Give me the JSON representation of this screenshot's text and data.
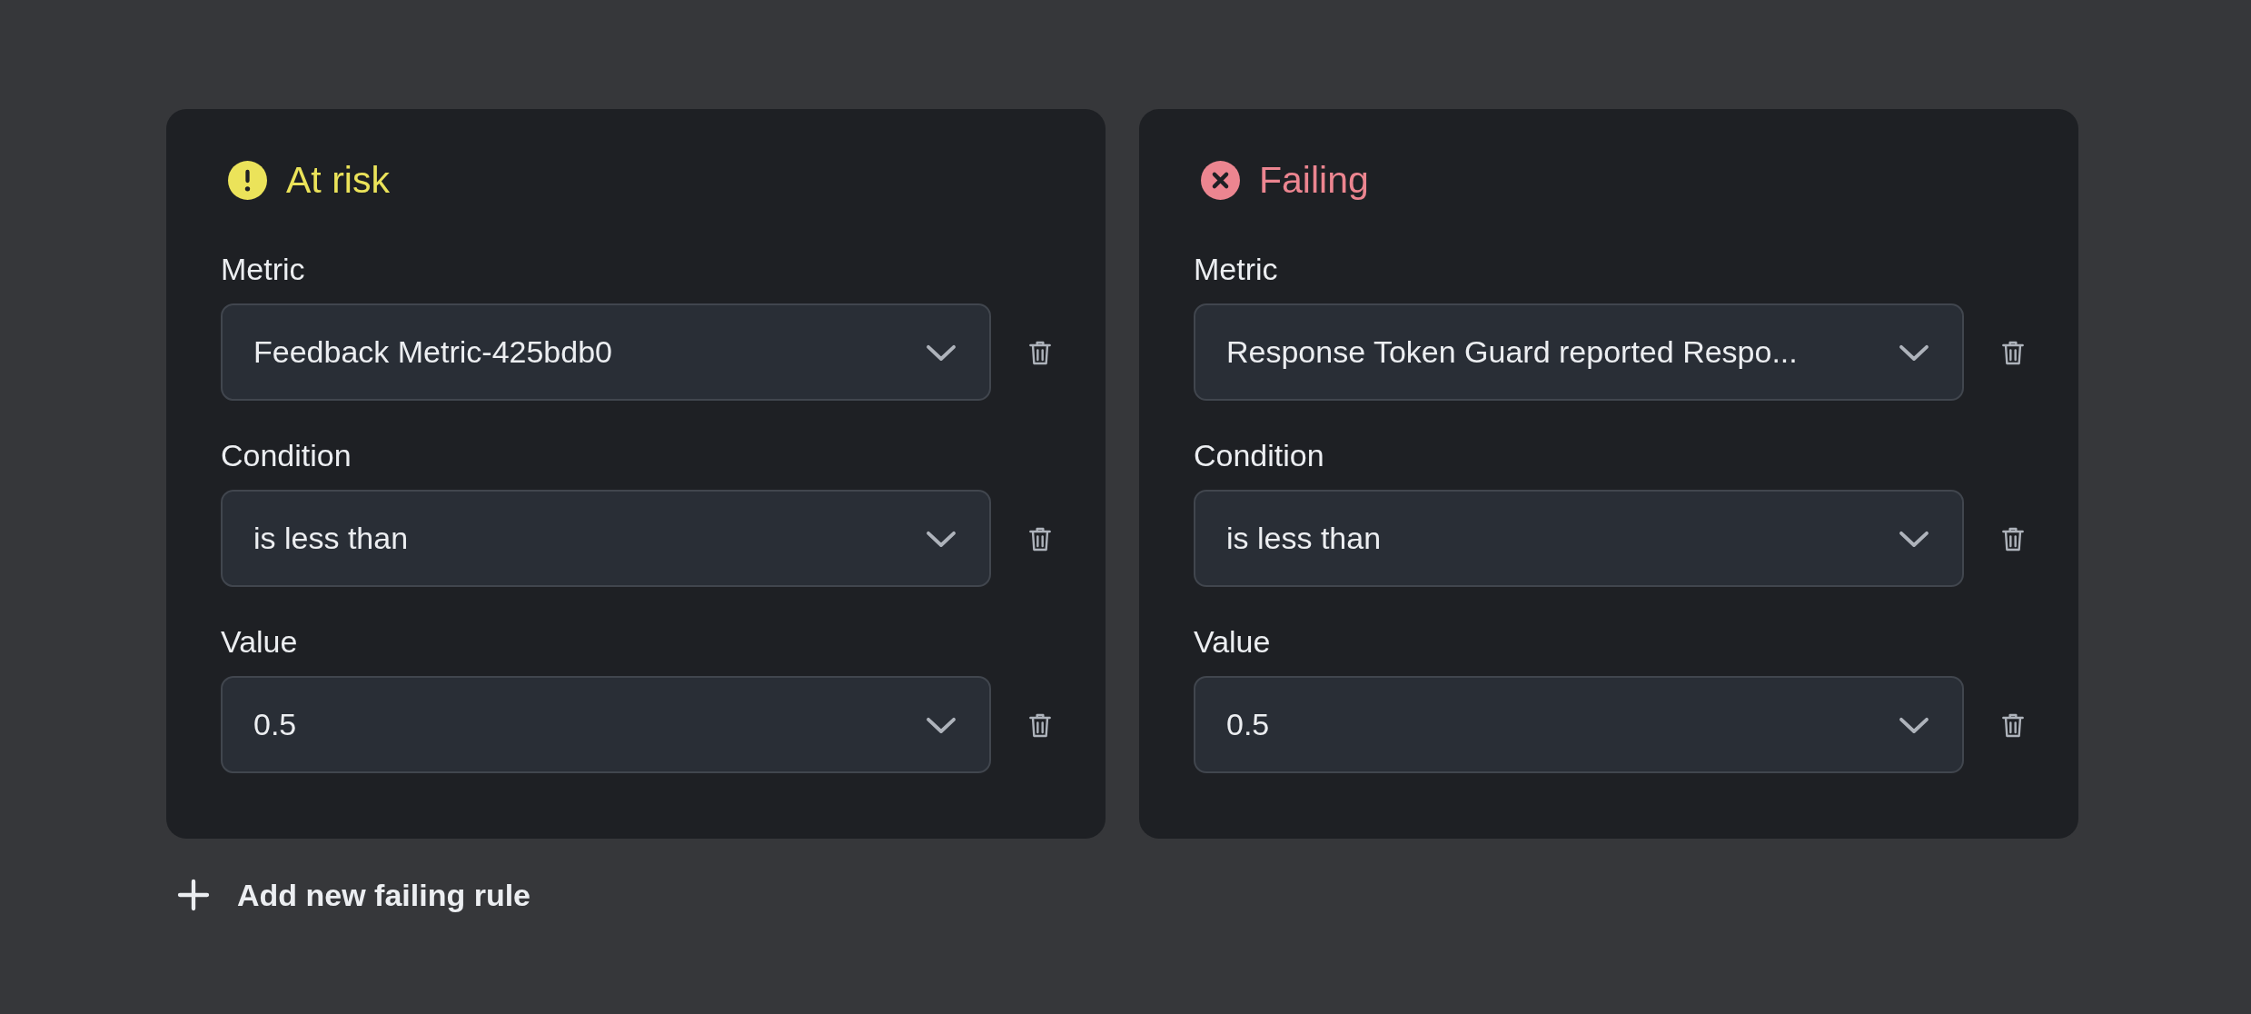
{
  "cards": [
    {
      "kind": "warning",
      "title": "At risk",
      "color": "#ebe35a",
      "fields": [
        {
          "label": "Metric",
          "value": "Feedback Metric-425bdb0"
        },
        {
          "label": "Condition",
          "value": "is less than"
        },
        {
          "label": "Value",
          "value": "0.5"
        }
      ]
    },
    {
      "kind": "error",
      "title": "Failing",
      "color": "#ec8590",
      "fields": [
        {
          "label": "Metric",
          "value": "Response Token Guard reported Respo..."
        },
        {
          "label": "Condition",
          "value": "is less than"
        },
        {
          "label": "Value",
          "value": "0.5"
        }
      ]
    }
  ],
  "add_button": {
    "label": "Add new failing rule"
  }
}
